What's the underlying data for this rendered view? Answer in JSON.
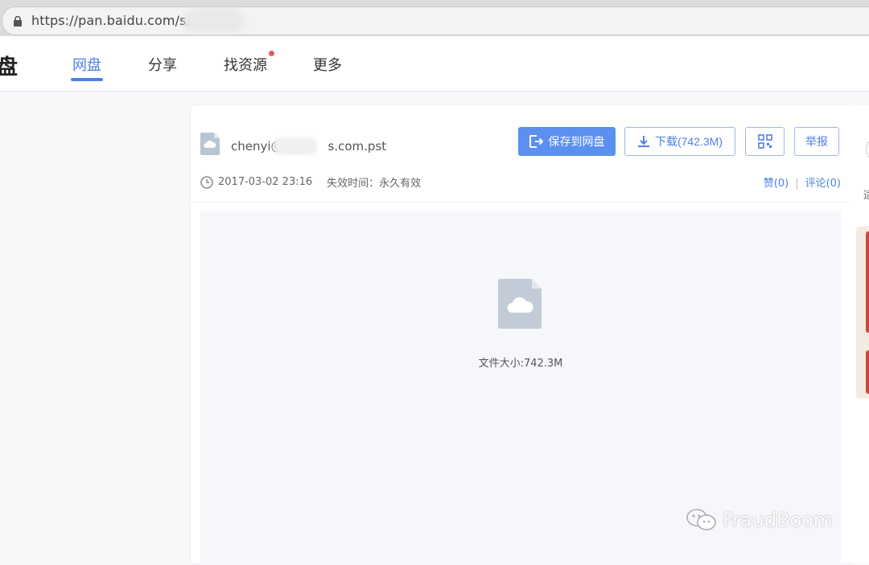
{
  "browser": {
    "url": "https://pan.baidu.com/s/1"
  },
  "nav": {
    "logo": "盘",
    "items": [
      {
        "label": "网盘",
        "active": true
      },
      {
        "label": "分享"
      },
      {
        "label": "找资源",
        "badge": true
      },
      {
        "label": "更多"
      }
    ]
  },
  "file": {
    "name_prefix": "chenyi@",
    "name_suffix": "s.com.pst",
    "date": "2017-03-02 23:16",
    "expire_label": "失效时间：永久有效",
    "size_text": "文件大小:742.3M"
  },
  "actions": {
    "save_label": "保存到网盘",
    "download_label": "下载(742.3M)",
    "report_label": "举报"
  },
  "social": {
    "like_label": "赞(0)",
    "comment_label": "评论(0)"
  },
  "side": {
    "partial_text": "适"
  },
  "watermark": {
    "text": "FraudBoom"
  },
  "colors": {
    "accent": "#4e7fe6",
    "primary_button": "#5b8ff0",
    "badge": "#e85c5c"
  }
}
